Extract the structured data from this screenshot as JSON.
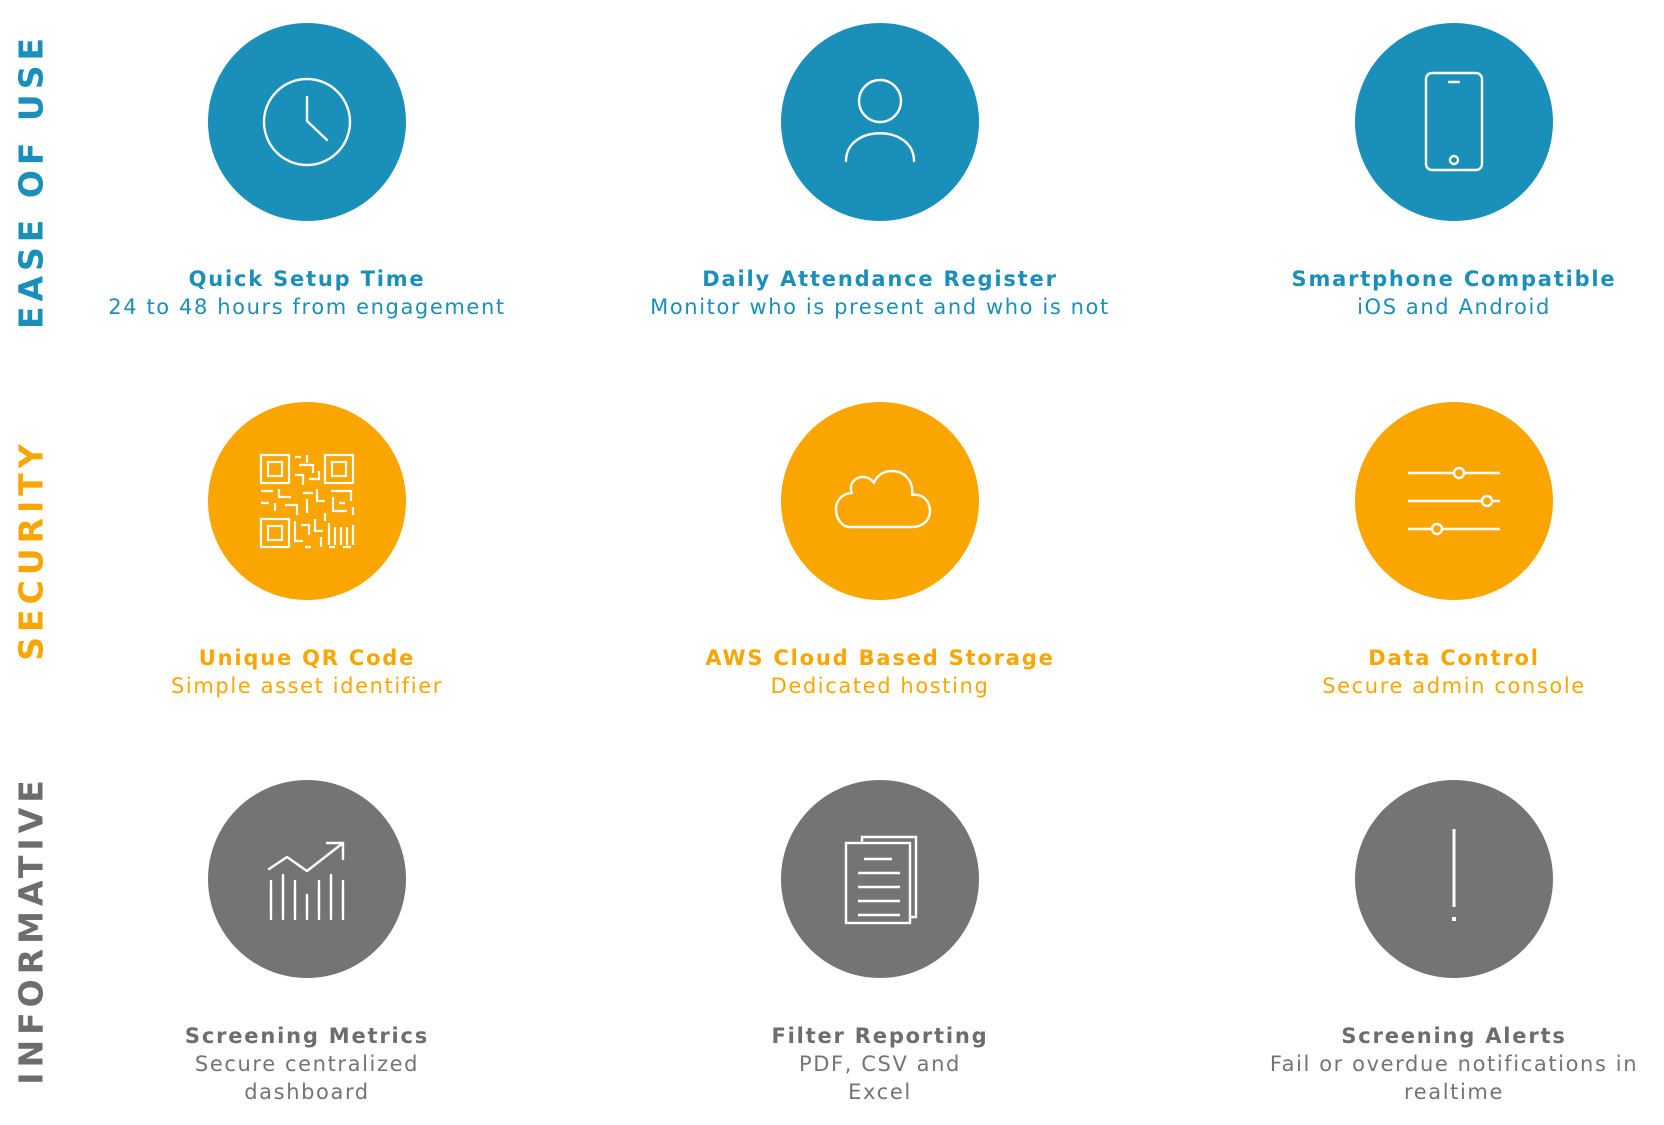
{
  "colors": {
    "ease_of_use": "#1a8fba",
    "security": "#fba600",
    "informative": "#747474"
  },
  "sections": [
    {
      "label": "EASE OF USE",
      "features": [
        {
          "icon": "clock-icon",
          "title": "Quick Setup Time",
          "subtitle": "24 to 48 hours from engagement"
        },
        {
          "icon": "user-icon",
          "title": "Daily Attendance Register",
          "subtitle": "Monitor who is present and who is not"
        },
        {
          "icon": "smartphone-icon",
          "title": "Smartphone Compatible",
          "subtitle": "iOS and Android"
        }
      ]
    },
    {
      "label": "SECURITY",
      "features": [
        {
          "icon": "qr-code-icon",
          "title": "Unique QR Code",
          "subtitle": "Simple asset identifier"
        },
        {
          "icon": "cloud-icon",
          "title": "AWS Cloud Based Storage",
          "subtitle": "Dedicated hosting"
        },
        {
          "icon": "sliders-icon",
          "title": "Data Control",
          "subtitle": "Secure admin console"
        }
      ]
    },
    {
      "label": "INFORMATIVE",
      "features": [
        {
          "icon": "chart-trend-icon",
          "title": "Screening Metrics",
          "subtitle": "Secure centralized dashboard"
        },
        {
          "icon": "documents-icon",
          "title": "Filter Reporting",
          "subtitle": "PDF, CSV and Excel"
        },
        {
          "icon": "alert-icon",
          "title": "Screening Alerts",
          "subtitle": "Fail or overdue notifications in realtime"
        }
      ]
    }
  ]
}
